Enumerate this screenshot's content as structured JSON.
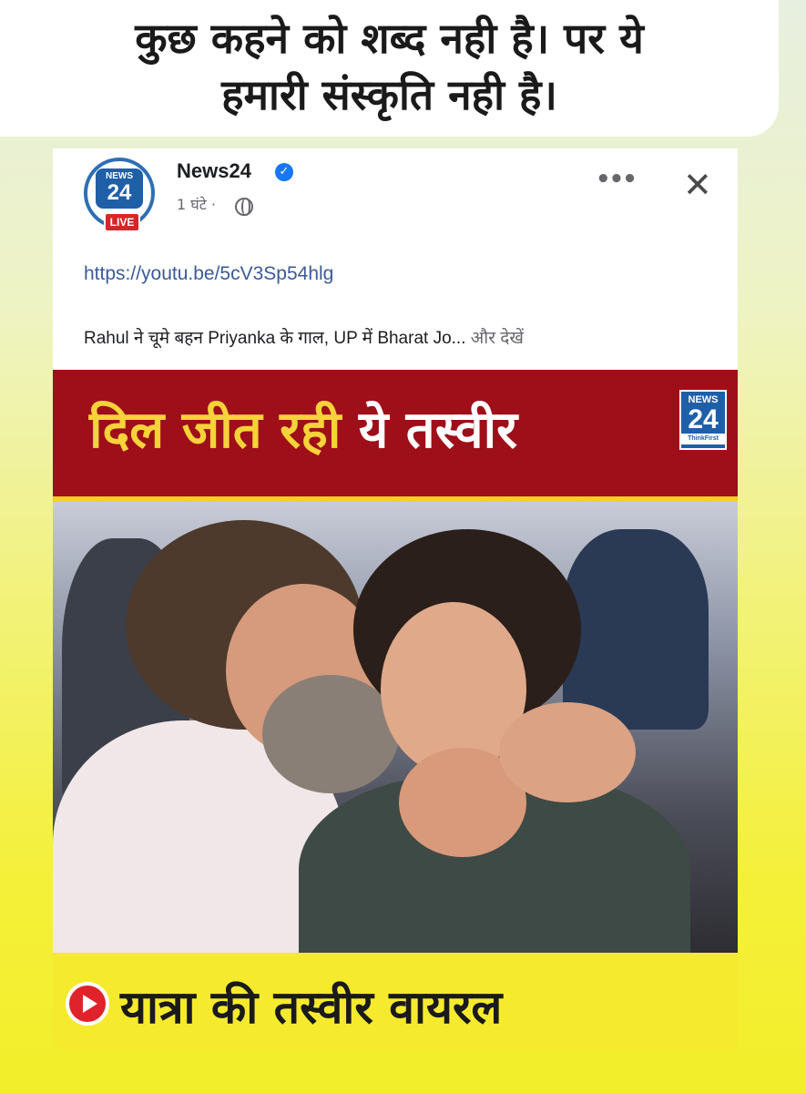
{
  "caption": {
    "line1": "कुछ कहने को शब्द नही है। पर ये",
    "line2": "हमारी संस्कृति नही है।"
  },
  "post": {
    "page_name": "News24",
    "time": "1 घंटे ·",
    "avatar_news": "NEWS",
    "avatar_num": "24",
    "live_badge": "LIVE",
    "link": "https://youtu.be/5cV3Sp54hlg",
    "text": "Rahul ने चूमे बहन Priyanka के गाल, UP में Bharat Jo...",
    "see_more": "और देखें",
    "icons": {
      "verified": "verified-badge-icon",
      "globe": "globe-icon",
      "more": "more-options-icon",
      "close": "close-icon",
      "play": "play-icon"
    }
  },
  "thumbnail": {
    "headline_part1": "दिल जीत रही ",
    "headline_part2": "ये तस्वीर",
    "logo_news": "NEWS",
    "logo_num": "24",
    "logo_tag": "ThinkFirst",
    "bottom_text": "यात्रा की तस्वीर वायरल",
    "colors": {
      "banner_red": "#9e0f1a",
      "banner_yellow": "#f6ea2e",
      "brand_blue": "#1f5fa8"
    }
  }
}
